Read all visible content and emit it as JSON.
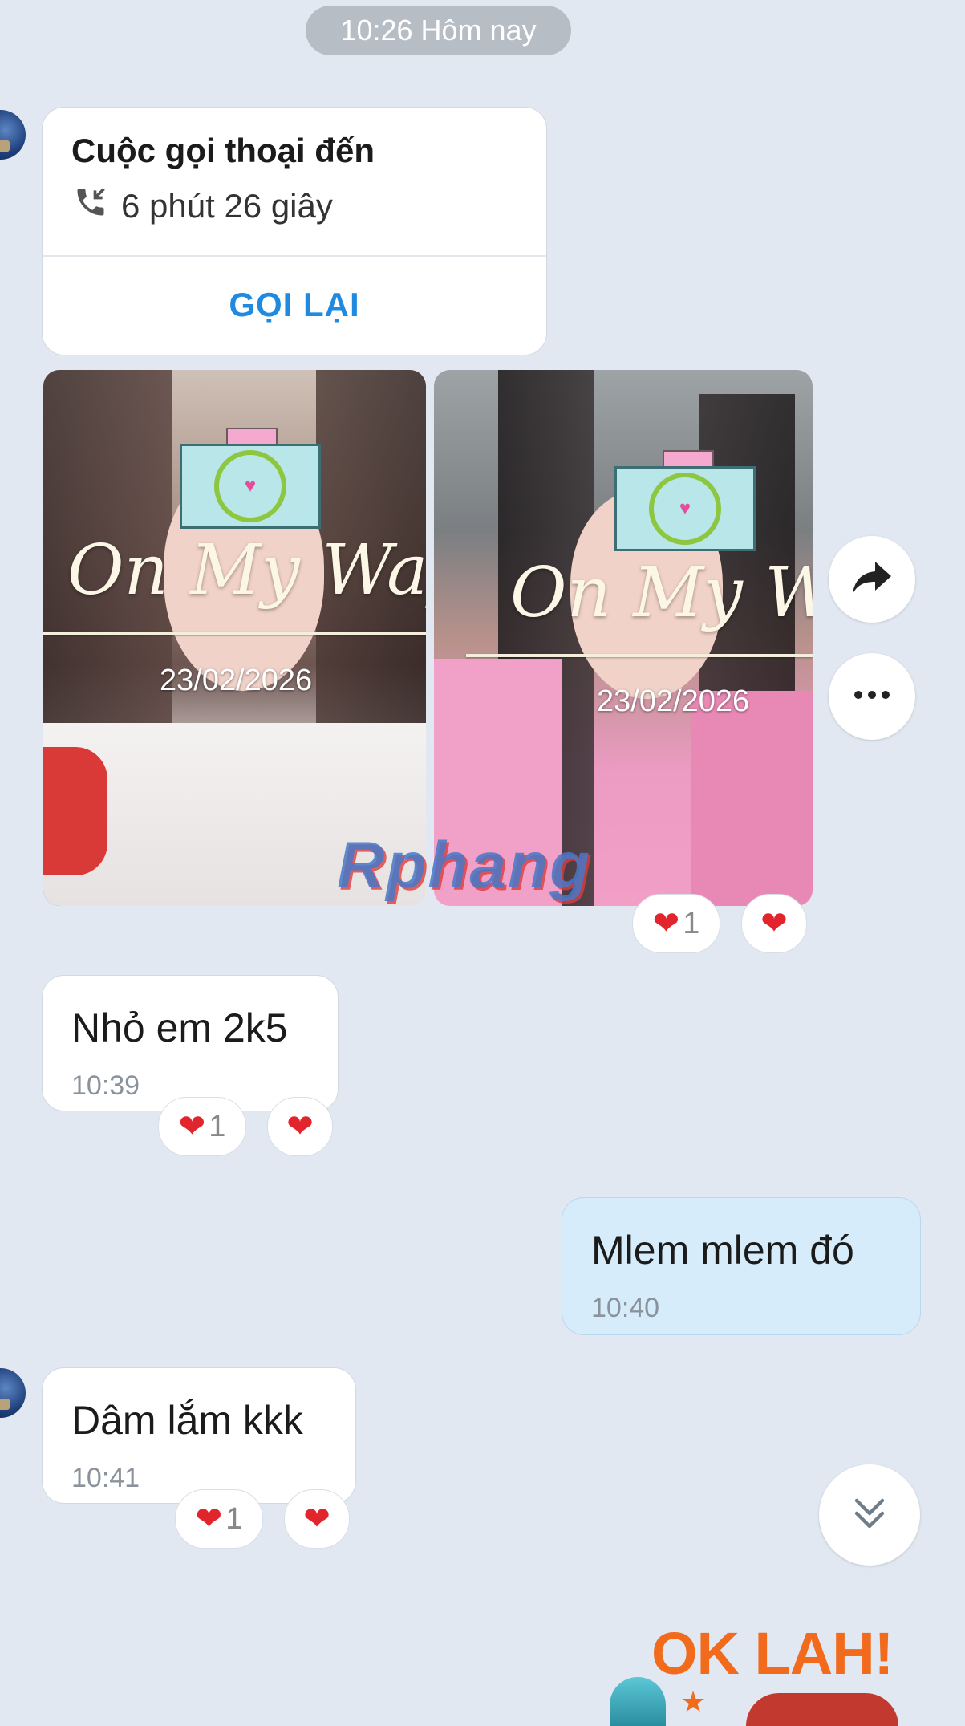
{
  "date_separator": "10:26 Hôm nay",
  "call_card": {
    "title": "Cuộc gọi thoại đến",
    "duration": "6 phút 26 giây",
    "callback_label": "GỌI LẠI",
    "icon": "incoming-call-icon"
  },
  "photos": [
    {
      "overlay_title": "On My Way",
      "date": "23/02/2026"
    },
    {
      "overlay_title": "On My Way",
      "date": "23/02/2026"
    }
  ],
  "photo_watermark": "Rphang",
  "photo_reactions": {
    "count": "1"
  },
  "messages": [
    {
      "direction": "in",
      "text": "Nhỏ em 2k5",
      "time": "10:39",
      "reaction_count": "1"
    },
    {
      "direction": "out",
      "text": "Mlem mlem đó",
      "time": "10:40"
    },
    {
      "direction": "in",
      "text": "Dâm lắm kkk",
      "time": "10:41",
      "reaction_count": "1"
    }
  ],
  "sticker_text": "OK LAH!",
  "icons": {
    "share": "share-forward-icon",
    "more": "more-horizontal-icon",
    "scroll_down": "double-chevron-down-icon",
    "reaction": "heart-icon"
  },
  "colors": {
    "background": "#e1e8f1",
    "accent": "#1f8ae0",
    "heart": "#e2242c",
    "outgoing_bubble": "#d6ecfb"
  }
}
